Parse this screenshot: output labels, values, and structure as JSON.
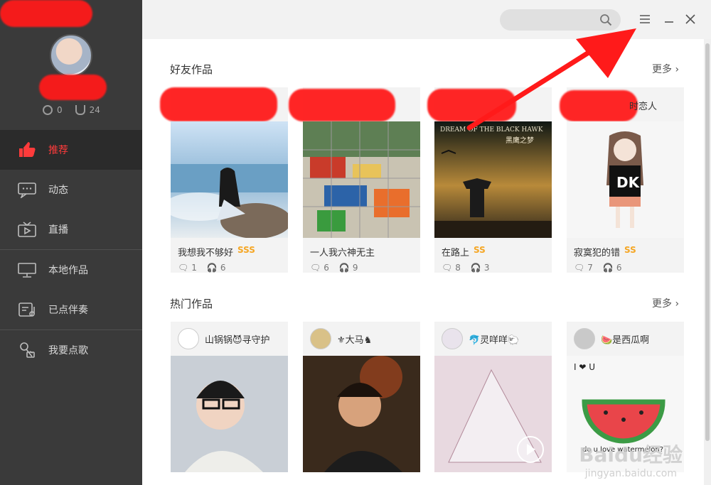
{
  "sidebar": {
    "stats": [
      {
        "icon": "k-coin-icon",
        "value": "0"
      },
      {
        "icon": "trophy-icon",
        "value": "24"
      }
    ],
    "nav": [
      {
        "label": "推荐",
        "icon": "thumbs-up-icon",
        "active": true
      },
      {
        "label": "动态",
        "icon": "chat-bubble-icon"
      },
      {
        "label": "直播",
        "icon": "tv-play-icon"
      },
      {
        "label": "本地作品",
        "icon": "monitor-icon"
      },
      {
        "label": "已点伴奏",
        "icon": "music-list-icon"
      },
      {
        "label": "我要点歌",
        "icon": "microphone-icon"
      }
    ]
  },
  "topbar": {
    "search_placeholder": "",
    "menu_icon": "menu-icon",
    "minimize_icon": "minimize-icon",
    "close_icon": "close-icon"
  },
  "friends_section": {
    "title": "好友作品",
    "more": "更多",
    "cards": [
      {
        "title": "我想我不够好",
        "grade": "SSS",
        "comments": "1",
        "listens": "6"
      },
      {
        "title": "一人我六神无主",
        "grade": "",
        "comments": "6",
        "listens": "9"
      },
      {
        "title": "在路上",
        "grade": "SS",
        "comments": "8",
        "listens": "3"
      },
      {
        "title": "寂寞犯的错",
        "grade": "SS",
        "comments": "7",
        "listens": "6",
        "head_partial": "时恋人"
      }
    ]
  },
  "hot_section": {
    "title": "热门作品",
    "more": "更多",
    "cards": [
      {
        "user": "山锅锅😈寻守护"
      },
      {
        "user": "⚜大马♞"
      },
      {
        "user": "🐬灵咩咩🐑"
      },
      {
        "user": "🍉是西瓜啊"
      }
    ]
  },
  "watermark": {
    "main": "Baidu经验",
    "sub": "jingyan.baidu.com"
  },
  "image_texts": {
    "poster_top": "DREAM OF THE BLACK HAWK",
    "poster_sub": "黑鹰之梦",
    "watermelon": "do u love watermelon?",
    "love": "I ❤ U"
  },
  "colors": {
    "accent": "#ff3b3b",
    "sidebar": "#3a3a3a",
    "grade": "#f5a623"
  }
}
